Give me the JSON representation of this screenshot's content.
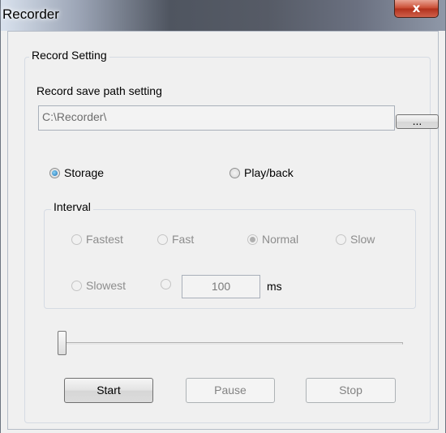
{
  "window": {
    "title": "Recorder",
    "close_label": "x"
  },
  "record_setting": {
    "legend": "Record Setting",
    "path_label": "Record save path setting",
    "path_value": "C:\\Recorder\\",
    "browse_label": "...",
    "mode": {
      "options": [
        "Storage",
        "Play/back"
      ],
      "selected": "Storage"
    },
    "interval": {
      "legend": "Interval",
      "options": [
        "Fastest",
        "Fast",
        "Normal",
        "Slow",
        "Slowest"
      ],
      "selected": "Normal",
      "custom_value": "100",
      "unit": "ms",
      "enabled": false
    },
    "slider": {
      "value": 0
    },
    "buttons": {
      "start": "Start",
      "pause": "Pause",
      "stop": "Stop"
    }
  }
}
